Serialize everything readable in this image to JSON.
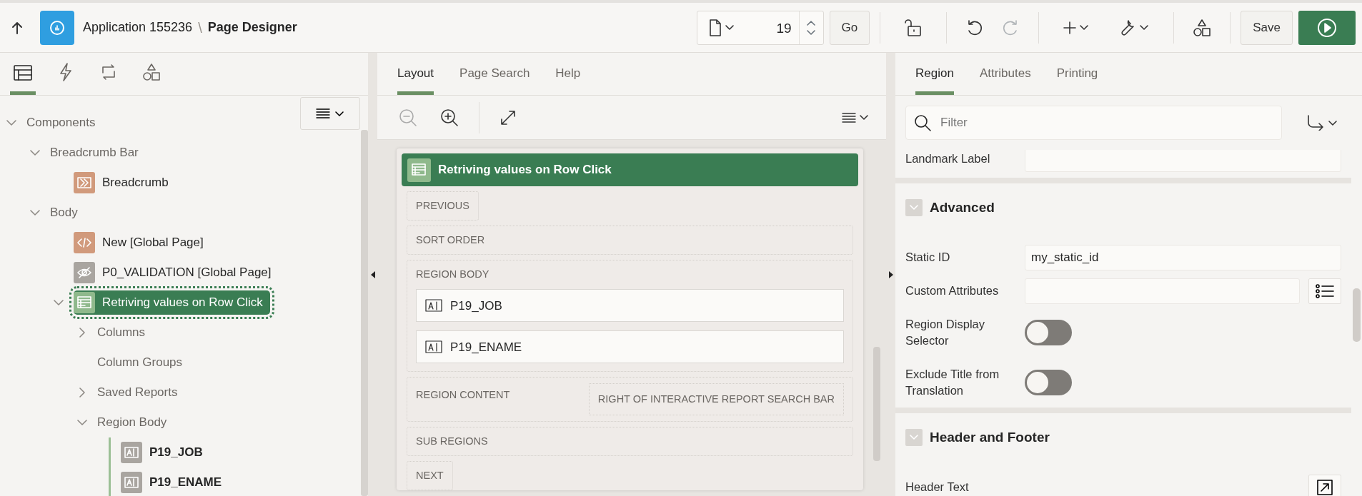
{
  "header": {
    "app_name": "Application 155236",
    "separator": "\\",
    "page_title": "Page Designer",
    "page_number": "19",
    "go": "Go",
    "save": "Save"
  },
  "left_tabs": [
    {
      "kind": "rendering",
      "selected": true
    },
    {
      "kind": "actions",
      "selected": false
    },
    {
      "kind": "processing",
      "selected": false
    },
    {
      "kind": "shared",
      "selected": false
    }
  ],
  "tree": [
    {
      "label": "Components",
      "expanded": true,
      "selected": false,
      "children": [
        {
          "label": "Breadcrumb Bar",
          "expanded": true,
          "selected": false,
          "children": [
            {
              "label": "Breadcrumb",
              "kind": "breadcrumb",
              "selected": false
            }
          ]
        },
        {
          "label": "Body",
          "expanded": true,
          "selected": false,
          "children": [
            {
              "label": "New [Global Page]",
              "kind": "code",
              "selected": false
            },
            {
              "label": "P0_VALIDATION [Global Page]",
              "kind": "hidden",
              "selected": false
            },
            {
              "label": "Retriving values on Row Click",
              "kind": "report",
              "expanded": true,
              "selected": true,
              "children": [
                {
                  "label": "Columns",
                  "expanded": false,
                  "selected": false
                },
                {
                  "label": "Column Groups",
                  "selected": false
                },
                {
                  "label": "Saved Reports",
                  "expanded": false,
                  "selected": false
                },
                {
                  "label": "Region Body",
                  "expanded": true,
                  "selected": false,
                  "children": [
                    {
                      "label": "P19_JOB",
                      "kind": "item",
                      "selected": false
                    },
                    {
                      "label": "P19_ENAME",
                      "kind": "item",
                      "selected": false
                    }
                  ]
                }
              ]
            }
          ]
        }
      ]
    }
  ],
  "middle_tabs": [
    {
      "label": "Layout",
      "selected": true
    },
    {
      "label": "Page Search",
      "selected": false
    },
    {
      "label": "Help",
      "selected": false
    }
  ],
  "layout": {
    "region_title": "Retriving values on Row Click",
    "slots": [
      {
        "kind": "button",
        "label": "PREVIOUS"
      },
      {
        "kind": "slot",
        "label": "SORT ORDER"
      },
      {
        "kind": "items",
        "label": "REGION BODY",
        "items": [
          "P19_JOB",
          "P19_ENAME"
        ]
      },
      {
        "kind": "split",
        "label": "REGION CONTENT",
        "right": "RIGHT OF INTERACTIVE REPORT SEARCH BAR"
      },
      {
        "kind": "slot",
        "label": "SUB REGIONS"
      },
      {
        "kind": "button",
        "label": "NEXT"
      }
    ]
  },
  "right_tabs": [
    {
      "label": "Region",
      "selected": true
    },
    {
      "label": "Attributes",
      "selected": false
    },
    {
      "label": "Printing",
      "selected": false
    }
  ],
  "filter": {
    "placeholder": "Filter"
  },
  "properties": [
    {
      "kind": "field",
      "label": "Landmark Label"
    },
    {
      "kind": "section",
      "title": "Advanced",
      "expanded": true
    },
    {
      "kind": "field",
      "label": "Static ID",
      "value": "my_static_id"
    },
    {
      "kind": "list_field",
      "label": "Custom Attributes"
    },
    {
      "kind": "switch",
      "label": "Region Display Selector",
      "on": false
    },
    {
      "kind": "switch",
      "label": "Exclude Title from Translation",
      "on": false
    },
    {
      "kind": "section",
      "title": "Header and Footer",
      "expanded": true
    },
    {
      "kind": "editor",
      "label": "Header Text"
    }
  ]
}
